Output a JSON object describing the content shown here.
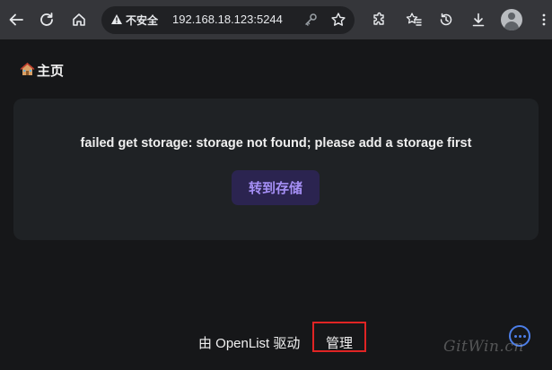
{
  "browser": {
    "security_label": "不安全",
    "url": "192.168.18.123:5244"
  },
  "page": {
    "breadcrumb": "主页",
    "error_message": "failed get storage: storage not found; please add a storage first",
    "go_storage_button": "转到存储",
    "footer": {
      "powered_by": "由 OpenList 驱动",
      "separator": "|",
      "manage_link": "管理"
    },
    "watermark": "GitWin.cn"
  },
  "colors": {
    "page_bg": "#161719",
    "card_bg": "#1f2225",
    "button_bg": "#2b2450",
    "button_text": "#a58ff5",
    "highlight_box": "#e02424",
    "chat_accent": "#4c7ee8"
  }
}
